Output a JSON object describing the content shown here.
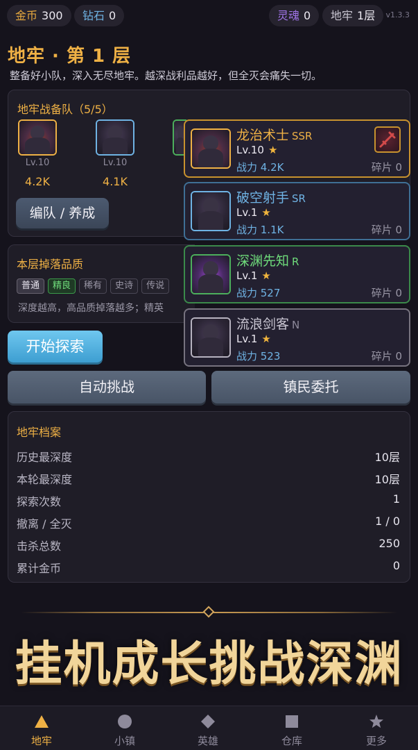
{
  "topbar": {
    "gold": {
      "label": "金币",
      "value": "300"
    },
    "diamond": {
      "label": "钻石",
      "value": "0"
    },
    "soul": {
      "label": "灵魂",
      "value": "0"
    },
    "floor": {
      "label": "地牢",
      "value": "1层"
    },
    "version": "v1.3.3"
  },
  "header": {
    "title": "地牢 · 第 1 层",
    "subtitle": "整备好小队，深入无尽地牢。越深战利品越好，但全灭会痛失一切。"
  },
  "squad": {
    "title": "地牢战备队（5/5）",
    "members": [
      {
        "level": "Lv.10",
        "power": "4.2K"
      },
      {
        "level": "Lv.10",
        "power": "4.1K"
      }
    ],
    "manage_label": "编队 / 养成"
  },
  "drops": {
    "title": "本层掉落品质",
    "qualities": [
      "普通",
      "精良",
      "稀有",
      "史诗",
      "传说"
    ],
    "hint": "深度越高，高品质掉落越多；精英"
  },
  "actions": {
    "explore": "开始探索",
    "auto": "自动挑战",
    "commission": "镇民委托"
  },
  "records": {
    "title": "地牢档案",
    "rows": [
      {
        "label": "历史最深度",
        "value": "10层"
      },
      {
        "label": "本轮最深度",
        "value": "10层"
      },
      {
        "label": "探索次数",
        "value": "1"
      },
      {
        "label": "撤离 / 全灭",
        "value": "1 / 0"
      },
      {
        "label": "击杀总数",
        "value": "250"
      },
      {
        "label": "累计金币",
        "value": "0"
      }
    ]
  },
  "hero_list": [
    {
      "name": "龙治术士",
      "rarity": "SSR",
      "level": "Lv.10",
      "power": "战力 4.2K",
      "fragments": "碎片 0",
      "color": "#efb145"
    },
    {
      "name": "破空射手",
      "rarity": "SR",
      "level": "Lv.1",
      "power": "战力 1.1K",
      "fragments": "碎片 0",
      "color": "#6fb3e4"
    },
    {
      "name": "深渊先知",
      "rarity": "R",
      "level": "Lv.1",
      "power": "战力 527",
      "fragments": "碎片 0",
      "color": "#6fdc7b"
    },
    {
      "name": "流浪剑客",
      "rarity": "N",
      "level": "Lv.1",
      "power": "战力 523",
      "fragments": "碎片 0",
      "color": "#c9c6d2"
    }
  ],
  "banner": "挂机成长挑战深渊",
  "nav": {
    "items": [
      {
        "label": "地牢",
        "icon": "triangle-icon"
      },
      {
        "label": "小镇",
        "icon": "circle-icon"
      },
      {
        "label": "英雄",
        "icon": "diamond-icon"
      },
      {
        "label": "仓库",
        "icon": "square-icon"
      },
      {
        "label": "更多",
        "icon": "star-icon"
      }
    ]
  }
}
